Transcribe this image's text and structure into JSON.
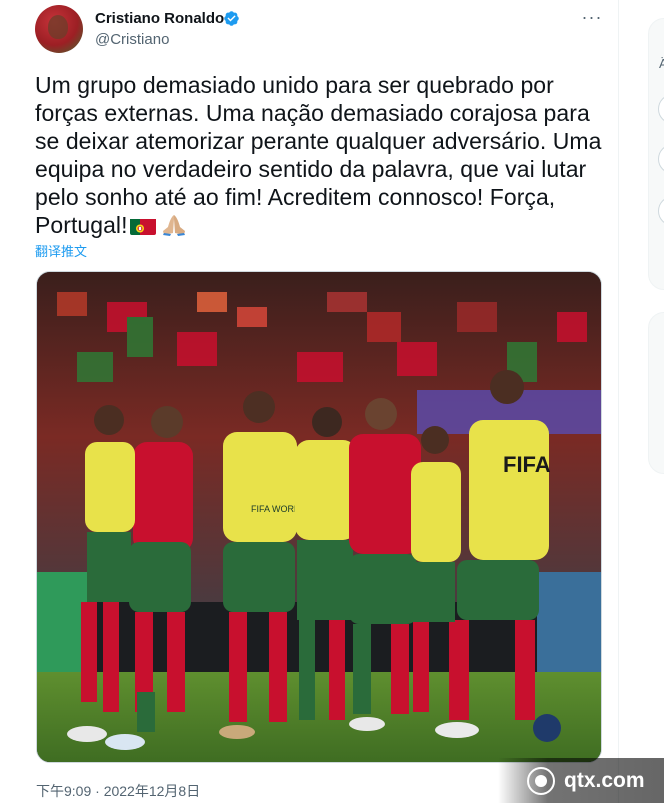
{
  "tweet": {
    "author_name": "Cristiano Ronaldo",
    "author_handle": "@Cristiano",
    "more_label": "···",
    "text": "Um grupo demasiado unido para ser quebrado por forças externas. Uma nação demasiado corajosa para se deixar atemorizar perante qualquer adversário. Uma equipa no verdadeiro sentido da palavra, que vai lutar pelo sonho até ao fim! Acreditem connosco! Força, Portugal!",
    "emojis": [
      "portugal-flag-icon",
      "folded-hands-icon"
    ],
    "translate_label": "翻译推文",
    "timestamp": "下午9:09 · 2022年12月8日",
    "media_alt": "Portugal team huddle"
  },
  "photo": {
    "jersey_text": "FIFA",
    "bib_text": "FIFA WORLD CUP Qatar2022"
  },
  "sidebar": {
    "partial_text": "Ä"
  },
  "watermark": {
    "text": "qtx.com"
  },
  "colors": {
    "link": "#1d9bf0",
    "verified": "#1d9bf0",
    "muted": "#536471",
    "portugal_red": "#c8102e",
    "portugal_green": "#046a38",
    "bib_yellow": "#e8e24a"
  }
}
